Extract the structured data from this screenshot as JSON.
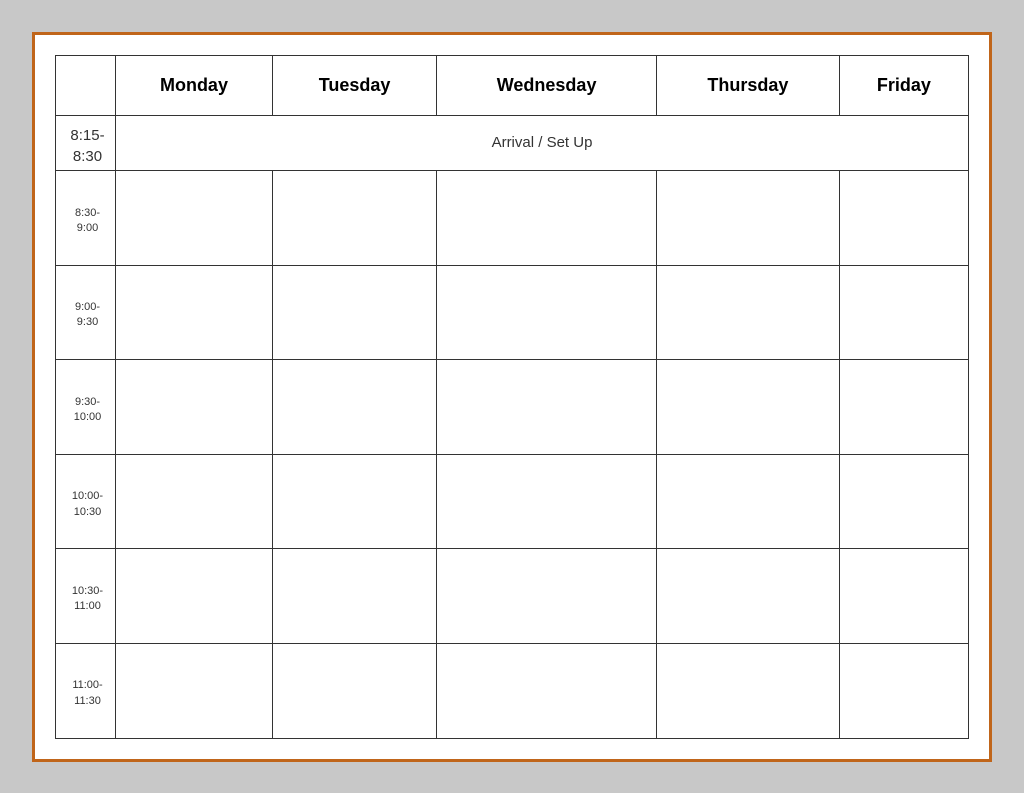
{
  "table": {
    "headers": {
      "empty": "",
      "monday": "Monday",
      "tuesday": "Tuesday",
      "wednesday": "Wednesday",
      "thursday": "Thursday",
      "friday": "Friday"
    },
    "arrival_text": "Arrival / Set Up",
    "time_slots": [
      {
        "id": "slot-815-830",
        "label": "8:15-\n8:30"
      },
      {
        "id": "slot-830-900",
        "label": "8:30-\n9:00"
      },
      {
        "id": "slot-900-930",
        "label": "9:00-\n9:30"
      },
      {
        "id": "slot-930-1000",
        "label": "9:30-\n10:00"
      },
      {
        "id": "slot-1000-1030",
        "label": "10:00-\n10:30"
      },
      {
        "id": "slot-1030-1100",
        "label": "10:30-\n11:00"
      },
      {
        "id": "slot-1100-1130",
        "label": "11:00-\n11:30"
      }
    ]
  }
}
